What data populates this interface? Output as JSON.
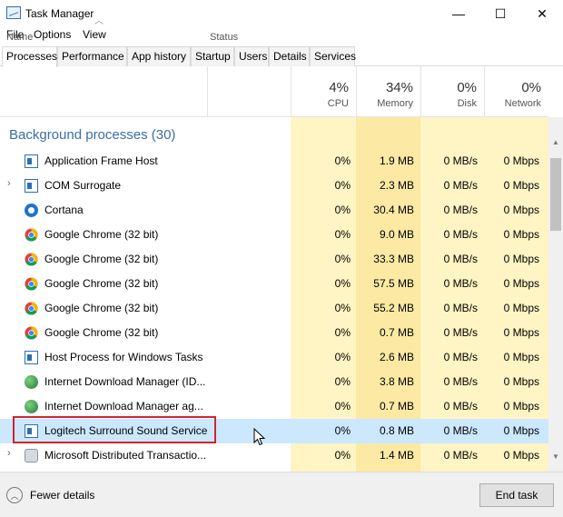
{
  "window": {
    "title": "Task Manager",
    "minimize": "—",
    "maximize": "☐",
    "close": "✕"
  },
  "menu": [
    "File",
    "Options",
    "View"
  ],
  "tabs": [
    "Processes",
    "Performance",
    "App history",
    "Startup",
    "Users",
    "Details",
    "Services"
  ],
  "columns": {
    "name": "Name",
    "status": "Status",
    "cpu": {
      "pct": "4%",
      "label": "CPU"
    },
    "memory": {
      "pct": "34%",
      "label": "Memory"
    },
    "disk": {
      "pct": "0%",
      "label": "Disk"
    },
    "network": {
      "pct": "0%",
      "label": "Network"
    }
  },
  "group_title": "Background processes (30)",
  "rows": [
    {
      "name": "Application Frame Host",
      "icon": "window-icon",
      "cpu": "0%",
      "mem": "1.9 MB",
      "disk": "0 MB/s",
      "net": "0 Mbps"
    },
    {
      "name": "COM Surrogate",
      "icon": "window-icon",
      "expand": "›",
      "cpu": "0%",
      "mem": "2.3 MB",
      "disk": "0 MB/s",
      "net": "0 Mbps"
    },
    {
      "name": "Cortana",
      "icon": "cortana-icon",
      "cpu": "0%",
      "mem": "30.4 MB",
      "disk": "0 MB/s",
      "net": "0 Mbps"
    },
    {
      "name": "Google Chrome (32 bit)",
      "icon": "chrome-icon",
      "cpu": "0%",
      "mem": "9.0 MB",
      "disk": "0 MB/s",
      "net": "0 Mbps"
    },
    {
      "name": "Google Chrome (32 bit)",
      "icon": "chrome-icon",
      "cpu": "0%",
      "mem": "33.3 MB",
      "disk": "0 MB/s",
      "net": "0 Mbps"
    },
    {
      "name": "Google Chrome (32 bit)",
      "icon": "chrome-icon",
      "cpu": "0%",
      "mem": "57.5 MB",
      "disk": "0 MB/s",
      "net": "0 Mbps"
    },
    {
      "name": "Google Chrome (32 bit)",
      "icon": "chrome-icon",
      "cpu": "0%",
      "mem": "55.2 MB",
      "disk": "0 MB/s",
      "net": "0 Mbps"
    },
    {
      "name": "Google Chrome (32 bit)",
      "icon": "chrome-icon",
      "cpu": "0%",
      "mem": "0.7 MB",
      "disk": "0 MB/s",
      "net": "0 Mbps"
    },
    {
      "name": "Host Process for Windows Tasks",
      "icon": "window-icon",
      "cpu": "0%",
      "mem": "2.6 MB",
      "disk": "0 MB/s",
      "net": "0 Mbps"
    },
    {
      "name": "Internet Download Manager (ID...",
      "icon": "idm-icon",
      "cpu": "0%",
      "mem": "3.8 MB",
      "disk": "0 MB/s",
      "net": "0 Mbps"
    },
    {
      "name": "Internet Download Manager ag...",
      "icon": "idm-icon",
      "cpu": "0%",
      "mem": "0.7 MB",
      "disk": "0 MB/s",
      "net": "0 Mbps"
    },
    {
      "name": "Logitech Surround Sound Service",
      "icon": "window-icon",
      "selected": true,
      "cpu": "0%",
      "mem": "0.8 MB",
      "disk": "0 MB/s",
      "net": "0 Mbps"
    },
    {
      "name": "Microsoft Distributed Transactio...",
      "icon": "ms-dtc-icon",
      "expand": "›",
      "cpu": "0%",
      "mem": "1.4 MB",
      "disk": "0 MB/s",
      "net": "0 Mbps"
    }
  ],
  "footer": {
    "fewer_details": "Fewer details",
    "end_task": "End task"
  },
  "colors": {
    "cpu_bg": "#fff4c4",
    "memory_bg": "#fbe9a4",
    "selected": "#cce8ff",
    "highlight": "#d0242d",
    "group_title": "#3a6ea5"
  }
}
